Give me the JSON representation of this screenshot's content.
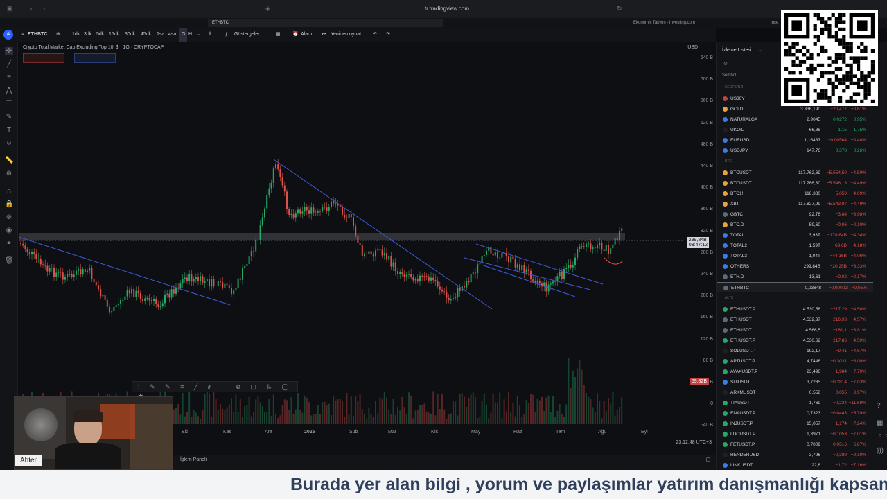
{
  "browser": {
    "url": "tr.tradingview.com",
    "tabs": [
      {
        "label": "ETHBTC"
      },
      {
        "label": "Ekonomik Takvim - Investing.com"
      }
    ],
    "partial_tab": "İnce"
  },
  "toolbar": {
    "symbol": "ETHBTC",
    "intervals": [
      "1dk",
      "3dk",
      "5dk",
      "15dk",
      "30dk",
      "45dk",
      "1sa",
      "4sa",
      "G",
      "H"
    ],
    "indicators_label": "Göstergeler",
    "alarm_label": "Alarm",
    "replay_label": "Yeniden oynat"
  },
  "chart": {
    "title": "Crypto Total Market Cap Excluding Top 10, $ · 1G · CRYPTOCAP",
    "currency": "USD",
    "current_price_label": "299,84B",
    "countdown": "03:47:12",
    "volume_label": "69,82B",
    "clock": "23:12:48 UTC+3",
    "price_ticks": [
      "640 B",
      "600 B",
      "560 B",
      "520 B",
      "480 B",
      "440 B",
      "400 B",
      "360 B",
      "320 B",
      "280 B",
      "240 B",
      "200 B",
      "160 B",
      "120 B",
      "80 B",
      "40 B",
      "0",
      "-40 B"
    ],
    "time_ticks": [
      "Eki",
      "Kas",
      "Ara",
      "2025",
      "Şub",
      "Mar",
      "Nis",
      "May",
      "Haz",
      "Tem",
      "Ağu",
      "Eyl"
    ]
  },
  "bottom_bar": {
    "label": "İşlem Paneli"
  },
  "watchlist": {
    "title": "İzleme Listesi",
    "column_label": "Sembol",
    "sections": [
      {
        "name": "SECTION 2",
        "rows": [
          {
            "symbol": "US30Y",
            "last": "",
            "chg": "",
            "pct": "",
            "color": "#c0443f"
          },
          {
            "symbol": "GOLD",
            "last": "3.336,190",
            "chg": "−20,477",
            "pct": "−0,61%",
            "color": "#e8a23a"
          },
          {
            "symbol": "NATURALGA",
            "last": "2,9045",
            "chg": "0,0272",
            "pct": "0,95%",
            "color": "#3a7be8"
          },
          {
            "symbol": "UKOIL",
            "last": "66,88",
            "chg": "1,15",
            "pct": "1,75%",
            "color": "#1f2024"
          },
          {
            "symbol": "EURUSD",
            "last": "1,16487",
            "chg": "−0,00564",
            "pct": "−0,48%",
            "color": "#3a7be8"
          },
          {
            "symbol": "USDJPY",
            "last": "147,76",
            "chg": "0,378",
            "pct": "0,26%",
            "color": "#3a7be8"
          }
        ]
      },
      {
        "name": "BTC",
        "rows": [
          {
            "symbol": "BTCUSDT",
            "last": "117.762,69",
            "chg": "−5.554,50",
            "pct": "−4,50%",
            "color": "#e8a23a"
          },
          {
            "symbol": "BTCUSDT",
            "last": "117.766,30",
            "chg": "−5.546,13",
            "pct": "−4,49%",
            "color": "#e8a23a"
          },
          {
            "symbol": "BTC1!",
            "last": "118.380",
            "chg": "−5.050",
            "pct": "−4,09%",
            "color": "#e8a23a"
          },
          {
            "symbol": "XBT",
            "last": "117.827,99",
            "chg": "−5.542,87",
            "pct": "−4,49%",
            "color": "#e8a23a"
          },
          {
            "symbol": "GBTC",
            "last": "92,76",
            "chg": "−3,84",
            "pct": "−3,98%",
            "color": "#5c6a7a"
          },
          {
            "symbol": "BTC.D",
            "last": "59,60",
            "chg": "−0,06",
            "pct": "−0,10%",
            "color": "#e8a23a"
          },
          {
            "symbol": "TOTAL",
            "last": "3,93T",
            "chg": "−178,64B",
            "pct": "−4,34%",
            "color": "#3a7be8"
          },
          {
            "symbol": "TOTAL2",
            "last": "1,59T",
            "chg": "−69,6B",
            "pct": "−4,18%",
            "color": "#3a7be8"
          },
          {
            "symbol": "TOTAL3",
            "last": "1,04T",
            "chg": "−44,16B",
            "pct": "−4,06%",
            "color": "#3a7be8"
          },
          {
            "symbol": "OTHERS",
            "last": "299,84B",
            "chg": "−20,25B",
            "pct": "−6,33%",
            "color": "#3a7be8"
          },
          {
            "symbol": "ETH.D",
            "last": "13,61",
            "chg": "−0,02",
            "pct": "−0,17%",
            "color": "#5c6a7a"
          },
          {
            "symbol": "ETHBTC",
            "last": "0,03848",
            "chg": "−0,00002",
            "pct": "−0,05%",
            "color": "#5c6a7a",
            "selected": true
          }
        ]
      },
      {
        "name": "ALTS",
        "rows": [
          {
            "symbol": "ETHUSDT.P",
            "last": "4.530,58",
            "chg": "−217,29",
            "pct": "−4,58%",
            "color": "#25a86a"
          },
          {
            "symbol": "ETHUSDT",
            "last": "4.532,37",
            "chg": "−216,93",
            "pct": "−4,57%",
            "color": "#5c6a7a"
          },
          {
            "symbol": "ETHUSDT",
            "last": "4.566,5",
            "chg": "−181,1",
            "pct": "−3,81%",
            "color": "#5c6a7a"
          },
          {
            "symbol": "ETHUSDT.P",
            "last": "4.530,62",
            "chg": "−217,86",
            "pct": "−4,59%",
            "color": "#25a86a"
          },
          {
            "symbol": "SOLUSDT.P",
            "last": "192,17",
            "chg": "−9,41",
            "pct": "−4,67%",
            "color": "#1f2024"
          },
          {
            "symbol": "APTUSDT.P",
            "last": "4,7446",
            "chg": "−0,3031",
            "pct": "−6,00%",
            "color": "#25a86a"
          },
          {
            "symbol": "AVAXUSDT.P",
            "last": "23,498",
            "chg": "−1,984",
            "pct": "−7,79%",
            "color": "#25a86a"
          },
          {
            "symbol": "SUIUSDT",
            "last": "3,7235",
            "chg": "−0,2814",
            "pct": "−7,03%",
            "color": "#3a7be8"
          },
          {
            "symbol": "ARKMUSDT",
            "last": "0,558",
            "chg": "−0,055",
            "pct": "−8,97%",
            "color": "#1f2024"
          },
          {
            "symbol": "TIAUSDT",
            "last": "1,769",
            "chg": "−0,234",
            "pct": "−11,68%",
            "color": "#25a86a"
          },
          {
            "symbol": "ENAUSDT.P",
            "last": "0,7323",
            "chg": "−0,0443",
            "pct": "−5,70%",
            "color": "#25a86a"
          },
          {
            "symbol": "INJUSDT.P",
            "last": "15,057",
            "chg": "−1,174",
            "pct": "−7,24%",
            "color": "#25a86a"
          },
          {
            "symbol": "LDOUSDT.P",
            "last": "1,3971",
            "chg": "−0,1053",
            "pct": "−7,01%",
            "color": "#25a86a"
          },
          {
            "symbol": "FETUSDT.P",
            "last": "0,7009",
            "chg": "−0,0516",
            "pct": "−6,87%",
            "color": "#25a86a"
          },
          {
            "symbol": "RENDERUSD",
            "last": "3,796",
            "chg": "−0,389",
            "pct": "−9,10%",
            "color": "#1f2024"
          },
          {
            "symbol": "LINKUSDT",
            "last": "22,6",
            "chg": "−1,72",
            "pct": "−7,16%",
            "color": "#3a7be8"
          }
        ]
      }
    ]
  },
  "webcam": {
    "name_label": "Ahter"
  },
  "ticker": {
    "text": "Burada yer alan bilgi , yorum ve paylaşımlar yatırım danışmanlığı kapsam"
  },
  "colors": {
    "up": "#25a86a",
    "down": "#e0504a",
    "trend_line": "#3f5bd8",
    "accent": "#2962ff"
  }
}
